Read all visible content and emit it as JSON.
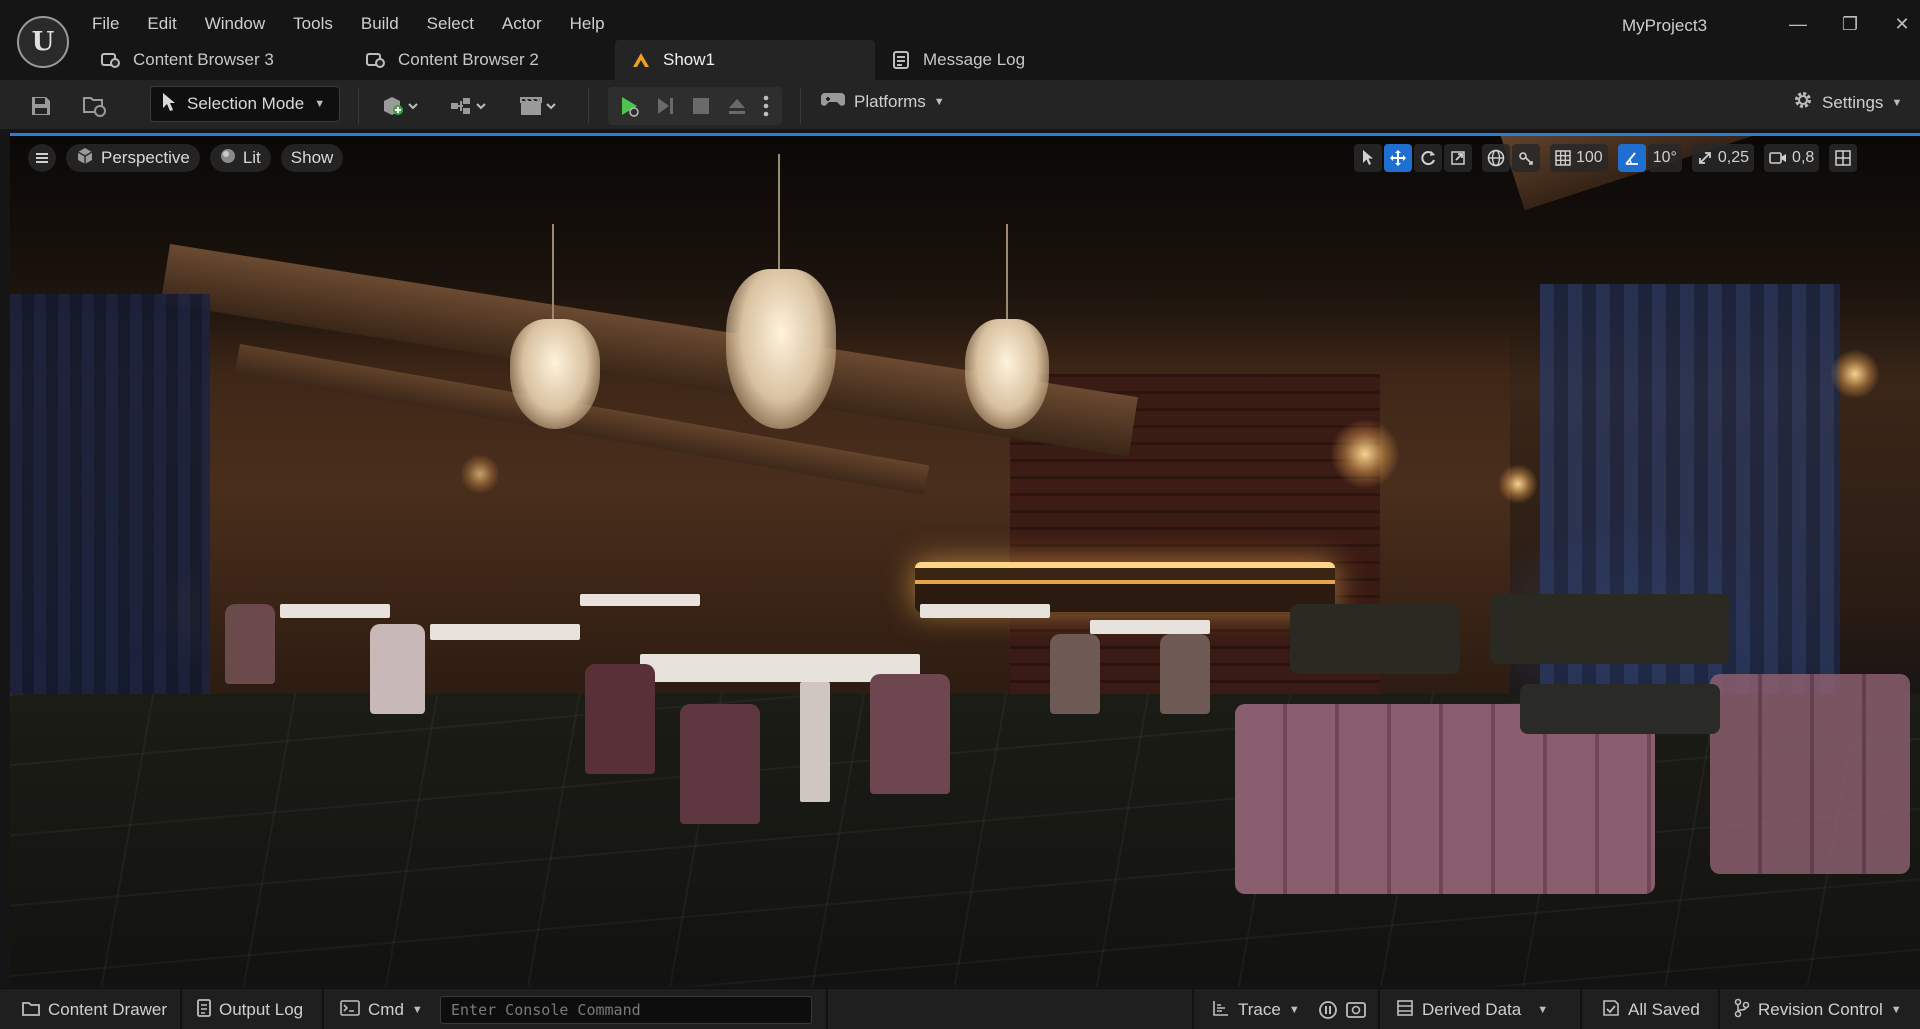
{
  "window": {
    "project_name": "MyProject3",
    "controls": {
      "minimize": "—",
      "restore": "❐",
      "close": "✕"
    }
  },
  "menu": [
    "File",
    "Edit",
    "Window",
    "Tools",
    "Build",
    "Select",
    "Actor",
    "Help"
  ],
  "tabs": [
    {
      "label": "Content Browser 3",
      "icon": "content-browser-icon",
      "active": false
    },
    {
      "label": "Content Browser 2",
      "icon": "content-browser-icon",
      "active": false
    },
    {
      "label": "Show1",
      "icon": "level-icon",
      "active": true
    },
    {
      "label": "Message Log",
      "icon": "message-log-icon",
      "active": false
    }
  ],
  "toolbar": {
    "mode": "Selection Mode",
    "platforms": "Platforms",
    "settings": "Settings"
  },
  "viewport": {
    "perspective": "Perspective",
    "lit": "Lit",
    "show": "Show",
    "grid_snap": "100",
    "rotation_snap": "10°",
    "scale_snap": "0,25",
    "camera_speed": "0,8"
  },
  "statusbar": {
    "content_drawer": "Content Drawer",
    "output_log": "Output Log",
    "cmd": "Cmd",
    "console_placeholder": "Enter Console Command",
    "trace": "Trace",
    "derived_data": "Derived Data",
    "all_saved": "All Saved",
    "revision_control": "Revision Control"
  },
  "colors": {
    "accent": "#1f6fd1",
    "play_green": "#4fc24f",
    "level_tab_icon": "#f0a020"
  }
}
